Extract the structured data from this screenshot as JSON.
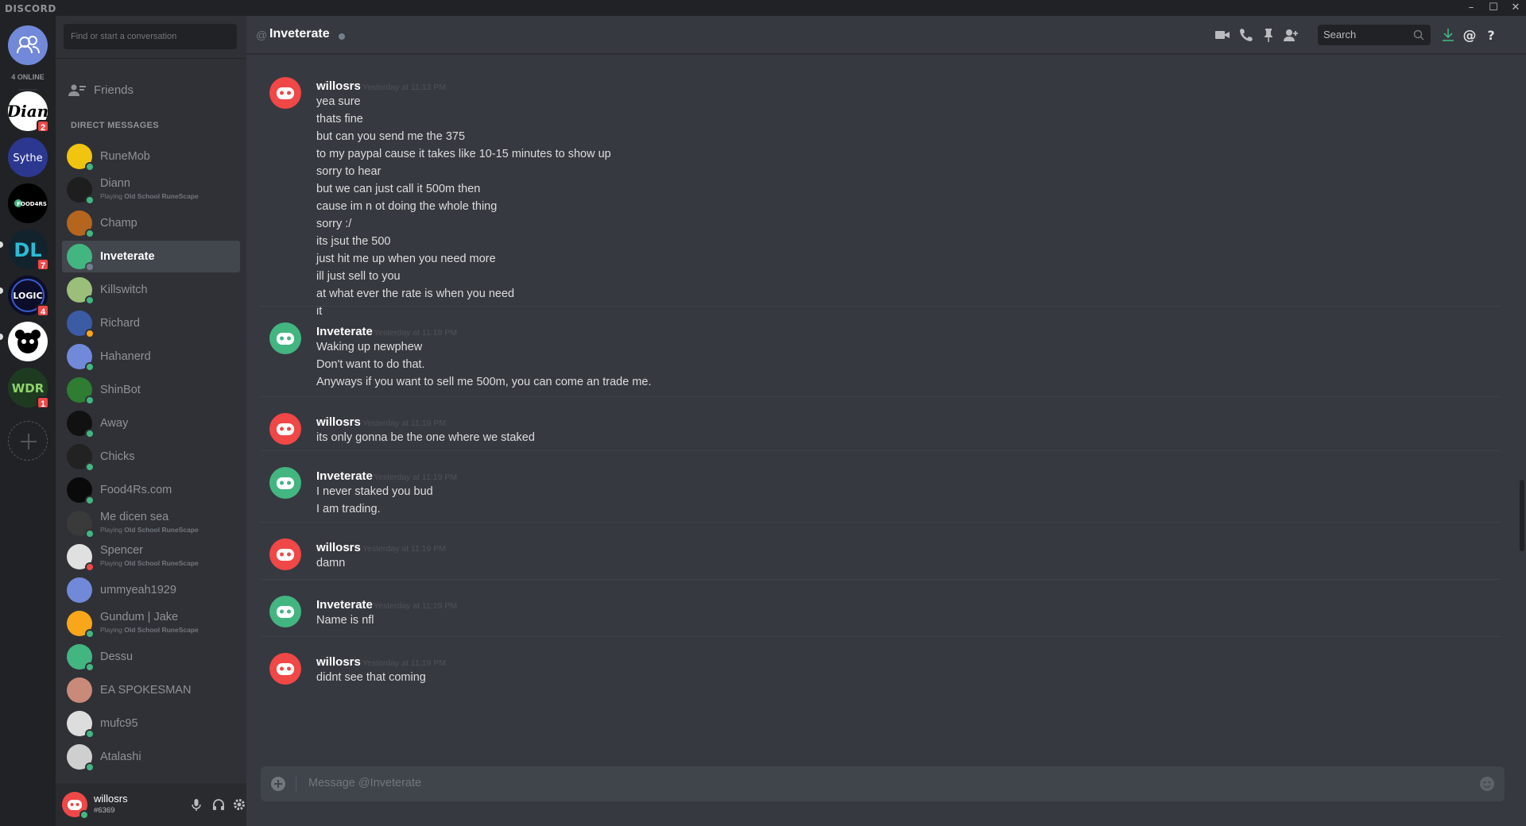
{
  "app": {
    "brand": "DISCORD",
    "window_controls": [
      "–",
      "☐",
      "✕"
    ]
  },
  "guilds": {
    "online_count": "4 ONLINE",
    "items": [
      {
        "name": "Diann",
        "icon": "diann-logo",
        "badge": "2"
      },
      {
        "name": "Sythe",
        "icon": "sythe-logo",
        "badge": ""
      },
      {
        "name": "Food4Rs",
        "icon": "food4rs-logo",
        "badge": ""
      },
      {
        "name": "DL",
        "icon": "dl-logo",
        "badge": "7"
      },
      {
        "name": "LOGIC",
        "icon": "logic-logo",
        "badge": "4"
      },
      {
        "name": "Panda",
        "icon": "panda-logo",
        "badge": ""
      },
      {
        "name": "WDR",
        "icon": "wdr-logo",
        "badge": "1"
      }
    ],
    "diann_text": "Dian",
    "sythe_text": "Sythe",
    "food_text": "FOOD4RS",
    "dl_text": "DL",
    "logic_text": "LOGIC",
    "wdr_text": "WDR"
  },
  "dm_sidebar": {
    "search_placeholder": "Find or start a conversation",
    "friends_label": "Friends",
    "header": "DIRECT MESSAGES",
    "items": [
      {
        "name": "RuneMob",
        "sub": "",
        "game": "",
        "status": "online",
        "avatar_color": "#f1c40f"
      },
      {
        "name": "Diann",
        "sub": "Playing ",
        "game": "Old School RuneScape",
        "status": "online",
        "avatar_color": "#1e1e1e"
      },
      {
        "name": "Champ",
        "sub": "",
        "game": "",
        "status": "online",
        "avatar_color": "#b5651d"
      },
      {
        "name": "Inveterate",
        "sub": "",
        "game": "",
        "status": "idle-gray",
        "avatar_color": "#43b581"
      },
      {
        "name": "Killswitch",
        "sub": "",
        "game": "",
        "status": "online",
        "avatar_color": "#9bbf7a"
      },
      {
        "name": "Richard",
        "sub": "",
        "game": "",
        "status": "idle",
        "avatar_color": "#3b5ba5"
      },
      {
        "name": "Hahanerd",
        "sub": "",
        "game": "",
        "status": "online",
        "avatar_color": "#7289da"
      },
      {
        "name": "ShinBot",
        "sub": "",
        "game": "",
        "status": "online",
        "avatar_color": "#2e7d32"
      },
      {
        "name": "Away",
        "sub": "",
        "game": "",
        "status": "online",
        "avatar_color": "#111111"
      },
      {
        "name": "Chicks",
        "sub": "",
        "game": "",
        "status": "online",
        "avatar_color": "#222222"
      },
      {
        "name": "Food4Rs.com",
        "sub": "",
        "game": "",
        "status": "online",
        "avatar_color": "#0a0a0a"
      },
      {
        "name": "Me dicen sea",
        "sub": "Playing ",
        "game": "Old School RuneScape",
        "status": "online",
        "avatar_color": "#3a3a3a"
      },
      {
        "name": "Spencer",
        "sub": "Playing ",
        "game": "Old School RuneScape",
        "status": "dnd",
        "avatar_color": "#e0e0e0"
      },
      {
        "name": "ummyeah1929",
        "sub": "",
        "game": "",
        "status": "none",
        "avatar_color": "#7289da"
      },
      {
        "name": "Gundum | Jake",
        "sub": "Playing ",
        "game": "Old School RuneScape",
        "status": "online",
        "avatar_color": "#faa61a"
      },
      {
        "name": "Dessu",
        "sub": "",
        "game": "",
        "status": "online",
        "avatar_color": "#43b581"
      },
      {
        "name": "EA SPOKESMAN",
        "sub": "",
        "game": "",
        "status": "none",
        "avatar_color": "#c98a7a"
      },
      {
        "name": "mufc95",
        "sub": "",
        "game": "",
        "status": "online",
        "avatar_color": "#dddddd"
      },
      {
        "name": "Atalashi",
        "sub": "",
        "game": "",
        "status": "online",
        "avatar_color": "#cfcfcf"
      }
    ]
  },
  "user_panel": {
    "username": "willosrs",
    "tag": "#6369"
  },
  "chat": {
    "at_symbol": "@",
    "channel_name": "Inveterate",
    "search_placeholder": "Search",
    "groups": [
      {
        "author": "willosrs",
        "avatar_color": "#f04747",
        "timestamp": "Yesterday at 11:13 PM",
        "lines": [
          "yea sure",
          "thats fine",
          "but can you send me the 375",
          "to my paypal cause it takes like 10-15 minutes to show up",
          "sorry to hear",
          "but we can just call it 500m then",
          "cause im n ot doing the whole thing",
          "sorry :/",
          "its jsut the 500",
          "just hit me up when you need more",
          "ill just sell to you",
          "at what ever the rate is when you need",
          "it"
        ]
      },
      {
        "author": "Inveterate",
        "avatar_color": "#43b581",
        "timestamp": "Yesterday at 11:18 PM",
        "lines": [
          "Waking up newphew",
          "Don't want to do that.",
          "Anyways if you want to sell me 500m, you can come an trade me."
        ]
      },
      {
        "author": "willosrs",
        "avatar_color": "#f04747",
        "timestamp": "Yesterday at 11:19 PM",
        "lines": [
          "its only gonna be the one where we staked"
        ]
      },
      {
        "author": "Inveterate",
        "avatar_color": "#43b581",
        "timestamp": "Yesterday at 11:19 PM",
        "lines": [
          "I never staked you bud",
          "I am trading."
        ]
      },
      {
        "author": "willosrs",
        "avatar_color": "#f04747",
        "timestamp": "Yesterday at 11:19 PM",
        "lines": [
          "damn"
        ]
      },
      {
        "author": "Inveterate",
        "avatar_color": "#43b581",
        "timestamp": "Yesterday at 11:19 PM",
        "lines": [
          "Name is nfl"
        ]
      },
      {
        "author": "willosrs",
        "avatar_color": "#f04747",
        "timestamp": "Yesterday at 11:19 PM",
        "lines": [
          "didnt see that coming"
        ]
      }
    ],
    "composer_placeholder": "Message @Inveterate"
  },
  "colors": {
    "online": "#43b581",
    "idle": "#faa61a",
    "dnd": "#f04747",
    "offline": "#747f8d",
    "accent": "#7289da"
  }
}
